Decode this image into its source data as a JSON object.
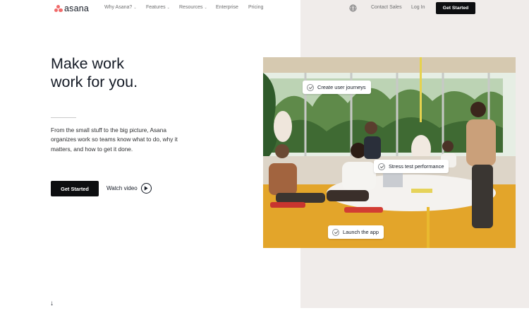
{
  "nav": {
    "logo_text": "asana",
    "items": [
      {
        "label": "Why Asana?",
        "dropdown": true
      },
      {
        "label": "Features",
        "dropdown": true
      },
      {
        "label": "Resources",
        "dropdown": true
      },
      {
        "label": "Enterprise",
        "dropdown": false
      },
      {
        "label": "Pricing",
        "dropdown": false
      }
    ],
    "globe_icon": "globe-icon",
    "contact_sales": "Contact Sales",
    "log_in": "Log In",
    "get_started": "Get Started"
  },
  "hero": {
    "title_line1": "Make work",
    "title_line2": "work for you.",
    "description": "From the small stuff to the big picture, Asana organizes work so teams know what to do, why it matters, and how to get it done.",
    "cta_label": "Get Started",
    "watch_label": "Watch video",
    "scroll_icon": "arrow-down-icon"
  },
  "photo": {
    "chips": [
      {
        "label": "Create user journeys"
      },
      {
        "label": "Stress test performance"
      },
      {
        "label": "Launch the app"
      }
    ]
  },
  "colors": {
    "logo_coral": "#f06a6a",
    "button_black": "#0d0e10",
    "panel_beige": "#f0ecea"
  }
}
